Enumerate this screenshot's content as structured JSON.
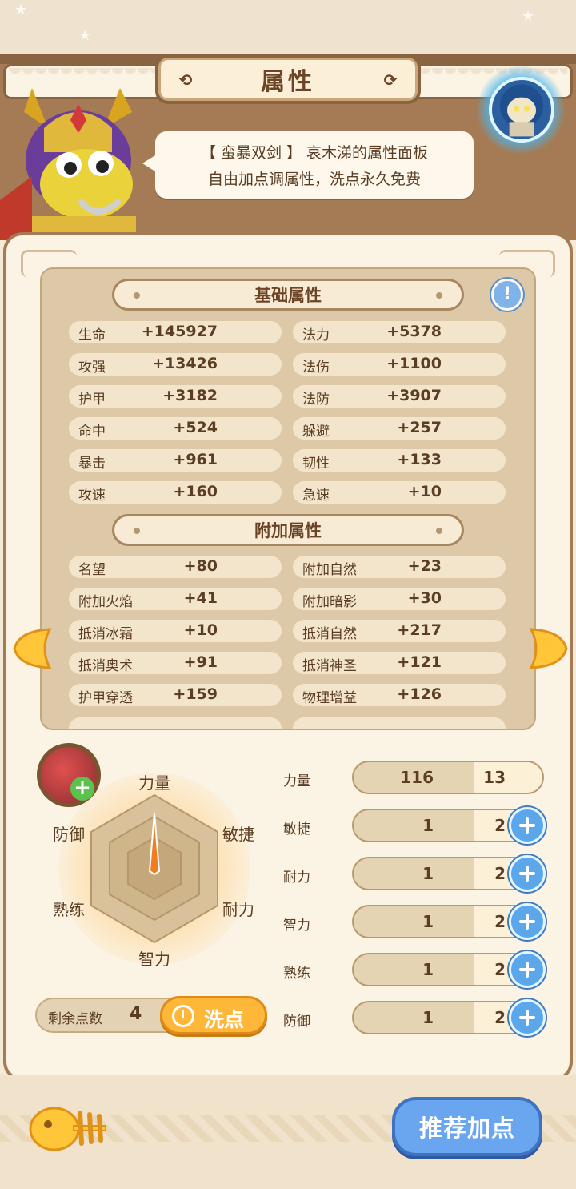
{
  "header": {
    "title": "属性"
  },
  "bubble": {
    "line1": "【 蛮暴双剑 】 哀木涕的属性面板",
    "line2": "自由加点调属性，洗点永久免费"
  },
  "basic": {
    "title": "基础属性",
    "left": [
      {
        "name": "生命",
        "value": "+145927"
      },
      {
        "name": "攻强",
        "value": "+13426"
      },
      {
        "name": "护甲",
        "value": "+3182"
      },
      {
        "name": "命中",
        "value": "+524"
      },
      {
        "name": "暴击",
        "value": "+961"
      },
      {
        "name": "攻速",
        "value": "+160"
      }
    ],
    "right": [
      {
        "name": "法力",
        "value": "+5378"
      },
      {
        "name": "法伤",
        "value": "+1100"
      },
      {
        "name": "法防",
        "value": "+3907"
      },
      {
        "name": "躲避",
        "value": "+257"
      },
      {
        "name": "韧性",
        "value": "+133"
      },
      {
        "name": "急速",
        "value": "+10"
      }
    ]
  },
  "extra": {
    "title": "附加属性",
    "left": [
      {
        "name": "名望",
        "value": "+80"
      },
      {
        "name": "附加火焰",
        "value": "+41"
      },
      {
        "name": "抵消冰霜",
        "value": "+10"
      },
      {
        "name": "抵消奥术",
        "value": "+91"
      },
      {
        "name": "护甲穿透",
        "value": "+159"
      }
    ],
    "right": [
      {
        "name": "附加自然",
        "value": "+23"
      },
      {
        "name": "附加暗影",
        "value": "+30"
      },
      {
        "name": "抵消自然",
        "value": "+217"
      },
      {
        "name": "抵消神圣",
        "value": "+121"
      },
      {
        "name": "物理增益",
        "value": "+126"
      }
    ]
  },
  "radar": {
    "labels": {
      "top": "力量",
      "top_right": "敏捷",
      "bottom_right": "耐力",
      "bottom": "智力",
      "bottom_left": "熟练",
      "top_left": "防御"
    }
  },
  "remain": {
    "label": "剩余点数",
    "value": "4",
    "wash_label": "洗点"
  },
  "attributes": [
    {
      "label": "力量",
      "base": "116",
      "add": "13",
      "has_plus": false
    },
    {
      "label": "敏捷",
      "base": "1",
      "add": "2",
      "has_plus": true
    },
    {
      "label": "耐力",
      "base": "1",
      "add": "2",
      "has_plus": true
    },
    {
      "label": "智力",
      "base": "1",
      "add": "2",
      "has_plus": true
    },
    {
      "label": "熟练",
      "base": "1",
      "add": "2",
      "has_plus": true
    },
    {
      "label": "防御",
      "base": "1",
      "add": "2",
      "has_plus": true
    }
  ],
  "footer": {
    "recommend_label": "推荐加点"
  },
  "colors": {
    "accent_orange": "#ffb73a",
    "accent_blue": "#6aa6f0",
    "panel": "#fbf3e3",
    "brown": "#a57b55"
  }
}
